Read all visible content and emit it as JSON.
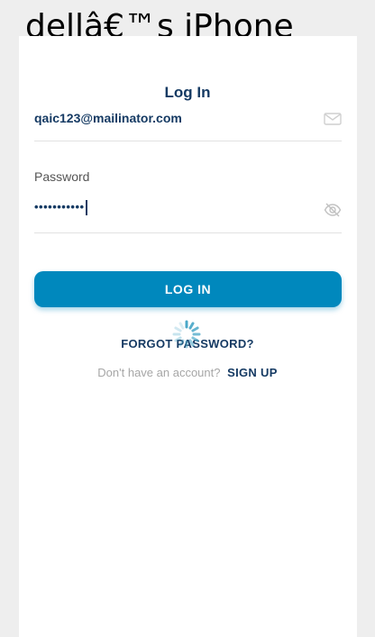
{
  "device": {
    "title": "dellâ€™s iPhone"
  },
  "login": {
    "title": "Log In",
    "email_value": "qaic123@mailinator.com",
    "email_icon": "mail-icon",
    "password_label": "Password",
    "password_value": "•••••••••••",
    "password_icon": "eye-off-icon",
    "login_button_label": "LOG IN",
    "forgot_password_label": "FORGOT PASSWORD?",
    "loading_indicator": "spinner-icon",
    "signup_prompt": "Don't have an account?",
    "signup_label": "SIGN UP"
  },
  "colors": {
    "primary": "#0088bd",
    "navy_text": "#153a63",
    "muted_text": "#a6a6a6",
    "background": "#eeeeee",
    "card": "#ffffff"
  }
}
